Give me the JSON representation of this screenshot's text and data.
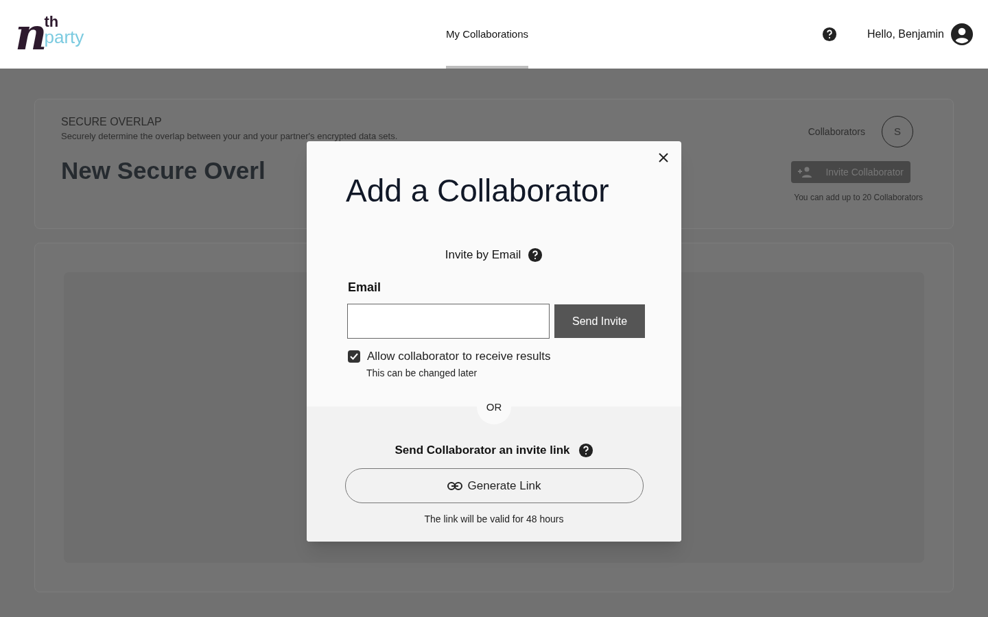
{
  "logo": {
    "letter": "n",
    "superscript": "th",
    "word": "party"
  },
  "nav": {
    "tabs": [
      {
        "label": "My Collaborations",
        "selected": true
      }
    ]
  },
  "header": {
    "greeting": "Hello, Benjamin"
  },
  "overlap_card": {
    "eyebrow": "SECURE OVERLAP",
    "description": "Securely determine the overlap between your and your partner's encrypted data sets.",
    "title": "New Secure Overl",
    "collaborators_label": "Collaborators",
    "avatars": [
      "S"
    ],
    "invite_button": "Invite Collaborator",
    "limit_note": "You can add up to 20 Collaborators"
  },
  "dialog": {
    "title": "Add a Collaborator",
    "invite_heading": "Invite by Email",
    "email_label": "Email",
    "send_button": "Send Invite",
    "allow_results": {
      "label": "Allow collaborator to receive results",
      "checked": true,
      "hint": "This can be changed later"
    },
    "divider": "OR",
    "link_heading": "Send Collaborator an invite link",
    "generate_button": "Generate Link",
    "link_note": "The link will be valid for 48 hours"
  }
}
